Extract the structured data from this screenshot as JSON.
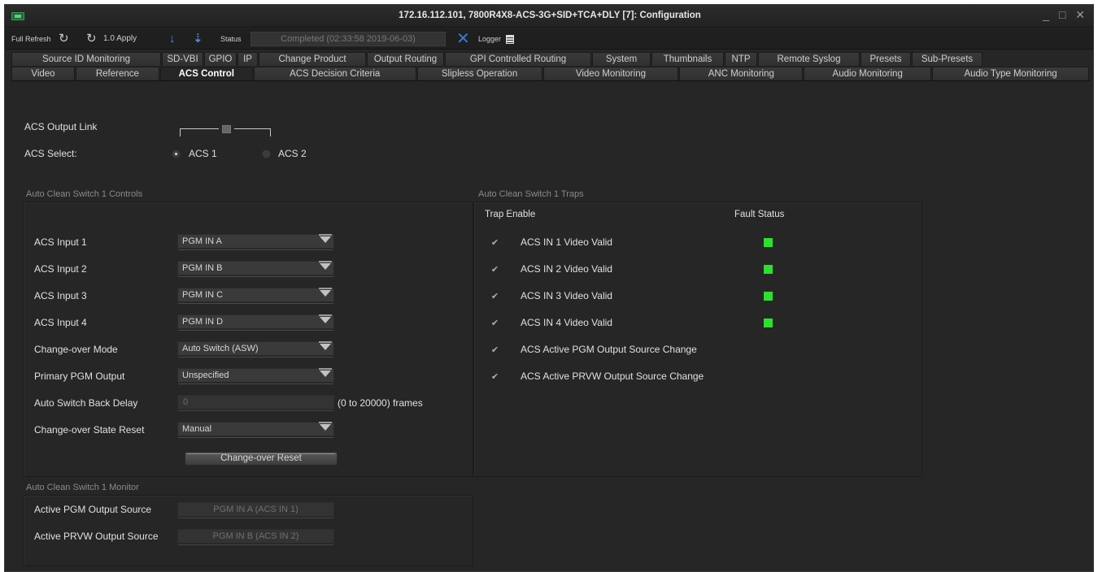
{
  "window": {
    "title": "172.16.112.101, 7800R4X8-ACS-3G+SID+TCA+DLY  [7]: Configuration",
    "controls": [
      "_",
      "□",
      "✕"
    ]
  },
  "toolbar": {
    "full_refresh": "Full Refresh",
    "apply_label": "1.0 Apply",
    "status_label": "Status",
    "status_value": "Completed  (02:33:58 2019-06-03)",
    "logger_label": "Logger"
  },
  "tabs_row1": [
    "Source ID Monitoring",
    "SD-VBI",
    "GPIO",
    "IP",
    "Change Product",
    "Output Routing",
    "GPI Controlled Routing",
    "System",
    "Thumbnails",
    "NTP",
    "Remote Syslog",
    "Presets",
    "Sub-Presets"
  ],
  "tabs_row2": [
    "Video",
    "Reference",
    "ACS Control",
    "ACS Decision Criteria",
    "Slipless Operation",
    "Video Monitoring",
    "ANC Monitoring",
    "Audio Monitoring",
    "Audio Type Monitoring"
  ],
  "active_tab": "ACS Control",
  "acs": {
    "output_link_label": "ACS Output Link",
    "select_label": "ACS Select:",
    "select_options": [
      "ACS 1",
      "ACS 2"
    ],
    "selected": "ACS 1"
  },
  "controls": {
    "title": "Auto Clean Switch 1 Controls",
    "rows": [
      {
        "label": "ACS Input 1",
        "value": "PGM IN A"
      },
      {
        "label": "ACS Input 2",
        "value": "PGM IN B"
      },
      {
        "label": "ACS Input 3",
        "value": "PGM IN C"
      },
      {
        "label": "ACS Input 4",
        "value": "PGM IN D"
      },
      {
        "label": "Change-over Mode",
        "value": "Auto Switch (ASW)"
      },
      {
        "label": "Primary PGM Output",
        "value": "Unspecified"
      }
    ],
    "delay_label": "Auto Switch Back Delay",
    "delay_value": "0",
    "delay_unit": "(0 to 20000) frames",
    "reset_label": "Change-over State Reset",
    "reset_value": "Manual",
    "reset_button": "Change-over Reset"
  },
  "traps": {
    "title": "Auto Clean Switch 1 Traps",
    "col_enable": "Trap Enable",
    "col_fault": "Fault Status",
    "rows": [
      {
        "label": "ACS IN 1 Video Valid",
        "checked": true,
        "fault_color": "#2ee02e"
      },
      {
        "label": "ACS IN 2 Video Valid",
        "checked": true,
        "fault_color": "#2ee02e"
      },
      {
        "label": "ACS IN 3 Video Valid",
        "checked": true,
        "fault_color": "#2ee02e"
      },
      {
        "label": "ACS IN 4 Video Valid",
        "checked": true,
        "fault_color": "#2ee02e"
      },
      {
        "label": "ACS Active PGM Output Source Change",
        "checked": true
      },
      {
        "label": "ACS Active PRVW Output Source Change",
        "checked": true
      }
    ]
  },
  "monitor": {
    "title": "Auto Clean Switch 1 Monitor",
    "rows": [
      {
        "label": "Active PGM Output Source",
        "value": "PGM IN A (ACS IN 1)"
      },
      {
        "label": "Active PRVW Output Source",
        "value": "PGM IN B (ACS IN 2)"
      }
    ]
  },
  "icons": {
    "refresh": "refresh-icon",
    "apply": "apply-icon",
    "download": "download-icon",
    "upload": "upload-icon",
    "logger_x": "logger-x-icon",
    "logger_grid": "logger-list-icon"
  }
}
